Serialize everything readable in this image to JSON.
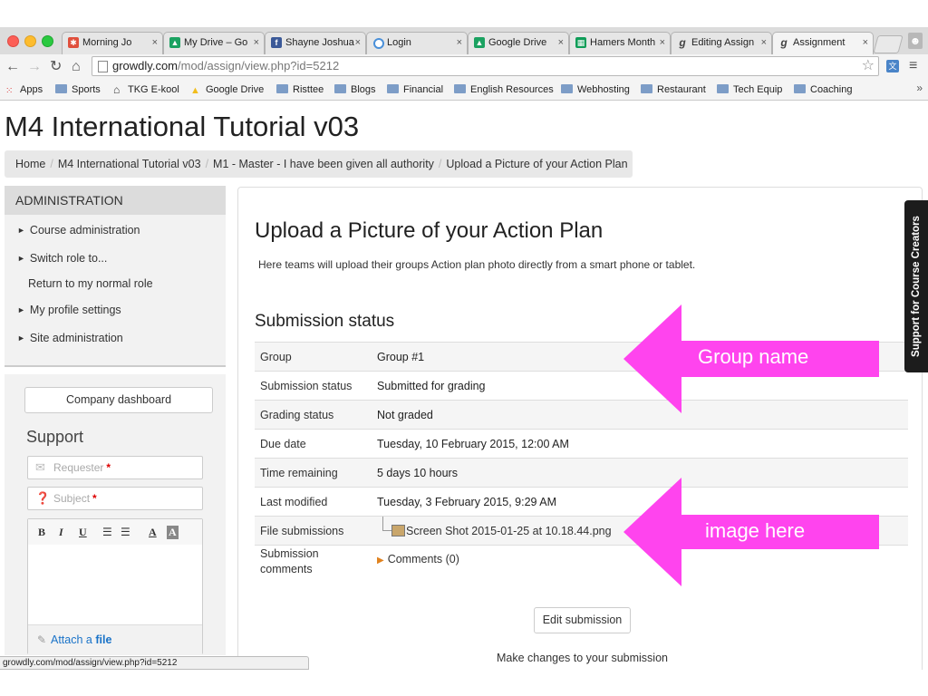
{
  "browser": {
    "tabs": [
      {
        "label": "Morning Jo",
        "icon": "nbc-icon",
        "color": "#e04f3c"
      },
      {
        "label": "My Drive – Go",
        "icon": "google-drive-icon",
        "color": "#1ba261"
      },
      {
        "label": "Shayne Joshua",
        "icon": "facebook-icon",
        "color": "#3b5998"
      },
      {
        "label": "Login",
        "icon": "loading-icon",
        "color": "#4a90d9"
      },
      {
        "label": "Google Drive",
        "icon": "google-drive-icon",
        "color": "#1ba261"
      },
      {
        "label": "Hamers Month",
        "icon": "sheets-icon",
        "color": "#0f9d58"
      },
      {
        "label": "Editing Assign",
        "icon": "growdly-icon",
        "color": "#555555"
      },
      {
        "label": "Assignment",
        "icon": "growdly-icon",
        "color": "#555555"
      }
    ],
    "url_host": "growdly.com",
    "url_path": "/mod/assign/view.php?id=5212",
    "bookmarks": [
      "Apps",
      "Sports",
      "TKG E-kool",
      "Google Drive",
      "Risttee",
      "Blogs",
      "Financial",
      "English Resources",
      "Webhosting",
      "Restaurant",
      "Tech Equip",
      "Coaching"
    ],
    "status_url": "growdly.com/mod/assign/view.php?id=5212"
  },
  "page": {
    "title": "M4 International Tutorial v03",
    "breadcrumb": [
      "Home",
      "M4 International Tutorial v03",
      "M1 - Master - I have been given all authority",
      "Upload a Picture of your Action Plan"
    ]
  },
  "sidebar": {
    "admin_title": "ADMINISTRATION",
    "admin_items": [
      "Course administration",
      "Switch role to...",
      "Return to my normal role",
      "My profile settings",
      "Site administration"
    ],
    "dashboard_button": "Company dashboard",
    "support_title": "Support",
    "requester_placeholder": "Requester",
    "subject_placeholder": "Subject",
    "required_mark": "*",
    "editor_tools": [
      "B",
      "I",
      "U",
      "☰",
      "☰",
      "A",
      "A"
    ],
    "attach_prefix": "Attach a",
    "attach_word": "file"
  },
  "main": {
    "heading": "Upload a Picture of your Action Plan",
    "description": "Here teams will upload their groups Action plan photo directly from a smart phone or tablet.",
    "submission_heading": "Submission status",
    "rows": [
      {
        "label": "Group",
        "value": "Group #1"
      },
      {
        "label": "Submission status",
        "value": "Submitted for grading"
      },
      {
        "label": "Grading status",
        "value": "Not graded"
      },
      {
        "label": "Due date",
        "value": "Tuesday, 10 February 2015, 12:00 AM"
      },
      {
        "label": "Time remaining",
        "value": "5 days 10 hours"
      },
      {
        "label": "Last modified",
        "value": "Tuesday, 3 February 2015, 9:29 AM"
      },
      {
        "label": "File submissions",
        "value": "Screen Shot 2015-01-25 at 10.18.44.png"
      },
      {
        "label": "Submission comments",
        "value": "Comments (0)"
      }
    ],
    "edit_button": "Edit submission",
    "edit_description": "Make changes to your submission"
  },
  "side_tab": "Support for Course Creators",
  "annotations": {
    "group_name": "Group name",
    "image_here": "image here",
    "color": "#ff44ee"
  }
}
